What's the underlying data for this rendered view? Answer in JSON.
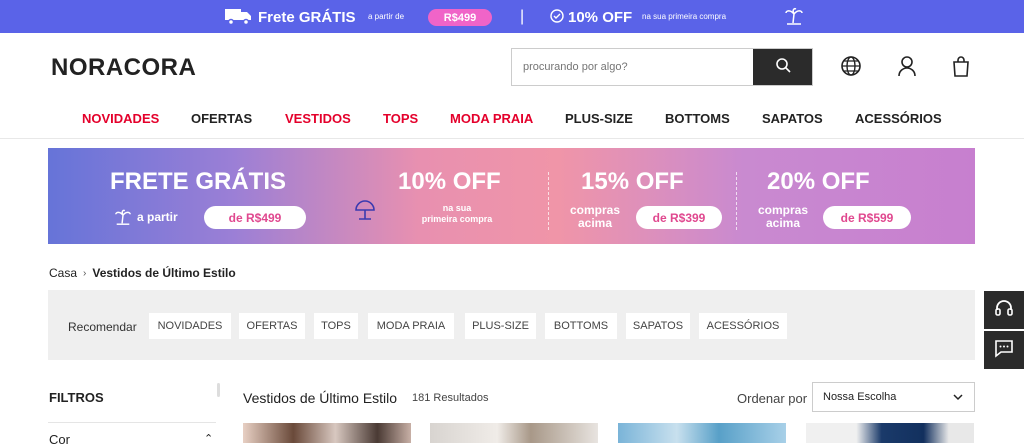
{
  "topbar": {
    "free_shipping": "Frete GRÁTIS",
    "from": "a partir de",
    "min_price": "R$499",
    "separator": "|",
    "discount": "10% OFF",
    "discount_sub": "na sua primeira compra",
    "bg_color": "#5a63e8",
    "pill_color": "#f064c8"
  },
  "header": {
    "logo": "NORACORA",
    "search_placeholder": "procurando por algo?",
    "icons": [
      "search-icon",
      "globe-icon",
      "user-icon",
      "bag-icon"
    ]
  },
  "nav": {
    "items": [
      {
        "label": "NOVIDADES",
        "color": "#e4002b"
      },
      {
        "label": "OFERTAS",
        "color": "#222222"
      },
      {
        "label": "VESTIDOS",
        "color": "#e4002b"
      },
      {
        "label": "TOPS",
        "color": "#e4002b"
      },
      {
        "label": "MODA PRAIA",
        "color": "#e4002b"
      },
      {
        "label": "PLUS-SIZE",
        "color": "#222222"
      },
      {
        "label": "BOTTOMS",
        "color": "#222222"
      },
      {
        "label": "SAPATOS",
        "color": "#222222"
      },
      {
        "label": "ACESSÓRIOS",
        "color": "#222222"
      }
    ]
  },
  "banner": {
    "free_title": "FRETE GRÁTIS",
    "free_from": "a partir",
    "free_pill": "de R$499",
    "off10": "10% OFF",
    "off10_sub1": "na sua",
    "off10_sub2": "primeira compra",
    "off15": "15% OFF",
    "off15_sub1": "compras",
    "off15_sub2": "acima",
    "off15_pill": "de R$399",
    "off20": "20% OFF",
    "off20_sub1": "compras",
    "off20_sub2": "acima",
    "off20_pill": "de R$599"
  },
  "breadcrumb": {
    "home": "Casa",
    "current": "Vestidos de Último Estilo"
  },
  "recommend": {
    "label": "Recomendar",
    "chips": [
      "NOVIDADES",
      "OFERTAS",
      "TOPS",
      "MODA PRAIA",
      "PLUS-SIZE",
      "BOTTOMS",
      "SAPATOS",
      "ACESSÓRIOS"
    ]
  },
  "filters": {
    "title": "FILTROS",
    "color_label": "Cor"
  },
  "results": {
    "title": "Vestidos de Último Estilo",
    "count": "181 Resultados",
    "sort_label": "Ordenar por",
    "sort_value": "Nossa Escolha"
  }
}
